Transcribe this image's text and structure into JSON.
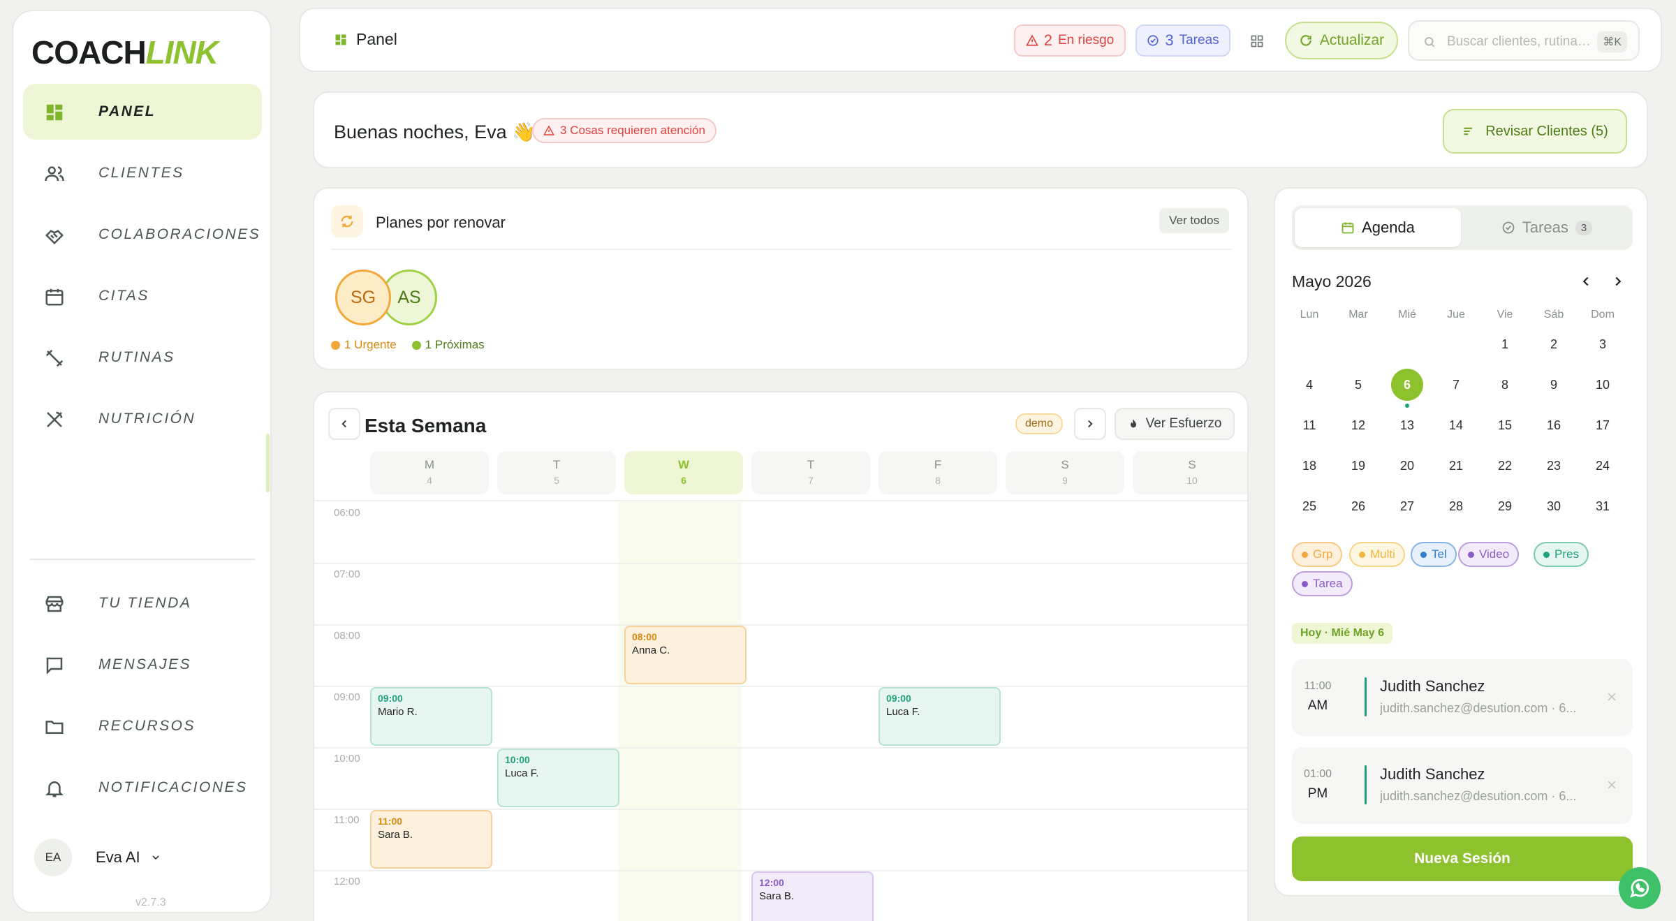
{
  "app": {
    "logo_part1": "COACH",
    "logo_part2": "LINK",
    "version": "v2.7.3",
    "brand_color": "#8dc12e"
  },
  "sidebar": {
    "nav": [
      {
        "label": "PANEL",
        "icon": "dashboard-icon",
        "active": true
      },
      {
        "label": "CLIENTES",
        "icon": "users-icon"
      },
      {
        "label": "COLABORACIONES",
        "icon": "handshake-icon"
      },
      {
        "label": "CITAS",
        "icon": "calendar-icon"
      },
      {
        "label": "RUTINAS",
        "icon": "dumbbell-icon"
      },
      {
        "label": "NUTRICIÓN",
        "icon": "utensils-icon"
      }
    ],
    "bottom_nav": [
      {
        "label": "TU TIENDA",
        "icon": "store-icon"
      },
      {
        "label": "MENSAJES",
        "icon": "message-icon"
      },
      {
        "label": "RECURSOS",
        "icon": "folder-icon"
      },
      {
        "label": "NOTIFICACIONES",
        "icon": "bell-icon"
      }
    ],
    "user": {
      "initials": "EA",
      "name": "Eva AI"
    }
  },
  "topbar": {
    "title": "Panel",
    "risk_count": "2",
    "risk_label": "En riesgo",
    "tasks_count": "3",
    "tasks_label": "Tareas",
    "refresh_label": "Actualizar",
    "search_placeholder": "Buscar clientes, rutinas...",
    "search_shortcut": "⌘K"
  },
  "greeting": {
    "text": "Buenas noches, Eva 👋",
    "attention": "3 Cosas requieren atención",
    "review_button": "Revisar Clientes (5)"
  },
  "plans": {
    "title": "Planes por renovar",
    "view_all": "Ver todos",
    "avatars": [
      "SG",
      "AS"
    ],
    "legend": [
      {
        "label": "1 Urgente",
        "color": "#f2a73a"
      },
      {
        "label": "1 Próximas",
        "color": "#8dc12e"
      }
    ]
  },
  "week": {
    "title": "Esta Semana",
    "demo_badge": "demo",
    "effort_button": "Ver Esfuerzo",
    "days": [
      {
        "letter": "M",
        "num": "4"
      },
      {
        "letter": "T",
        "num": "5"
      },
      {
        "letter": "W",
        "num": "6",
        "today": true
      },
      {
        "letter": "T",
        "num": "7"
      },
      {
        "letter": "F",
        "num": "8"
      },
      {
        "letter": "S",
        "num": "9"
      },
      {
        "letter": "S",
        "num": "10"
      }
    ],
    "hours": [
      "06:00",
      "07:00",
      "08:00",
      "09:00",
      "10:00",
      "11:00",
      "12:00"
    ],
    "events": [
      {
        "time": "08:00",
        "name": "Anna C.",
        "day": 2,
        "color": "orange"
      },
      {
        "time": "09:00",
        "name": "Mario R.",
        "day": 0,
        "color": "teal"
      },
      {
        "time": "09:00",
        "name": "Luca F.",
        "day": 4,
        "color": "teal"
      },
      {
        "time": "10:00",
        "name": "Luca F.",
        "day": 1,
        "color": "teal"
      },
      {
        "time": "11:00",
        "name": "Sara B.",
        "day": 0,
        "color": "orange"
      },
      {
        "time": "12:00",
        "name": "Sara B.",
        "day": 3,
        "color": "purple"
      }
    ]
  },
  "agenda": {
    "tab_agenda": "Agenda",
    "tab_tasks": "Tareas",
    "tab_tasks_count": "3",
    "month": "Mayo 2026",
    "weekdays": [
      "Lun",
      "Mar",
      "Mié",
      "Jue",
      "Vie",
      "Sáb",
      "Dom"
    ],
    "today": "6",
    "chips": [
      {
        "label": "Grp",
        "color": "#f2a73a"
      },
      {
        "label": "Multi",
        "color": "#f2b73a"
      },
      {
        "label": "Tel",
        "color": "#2f7fd0"
      },
      {
        "label": "Video",
        "color": "#8a5bc7"
      },
      {
        "label": "Pres",
        "color": "#21a07e"
      },
      {
        "label": "Tarea",
        "color": "#8a5bc7"
      }
    ],
    "today_label": "Hoy · Mié May 6",
    "sessions": [
      {
        "hour": "11:00",
        "ampm": "AM",
        "name": "Judith Sanchez",
        "email": "judith.sanchez@desution.com · 6..."
      },
      {
        "hour": "01:00",
        "ampm": "PM",
        "name": "Judith Sanchez",
        "email": "judith.sanchez@desution.com · 6..."
      }
    ],
    "new_session": "Nueva Sesión"
  }
}
